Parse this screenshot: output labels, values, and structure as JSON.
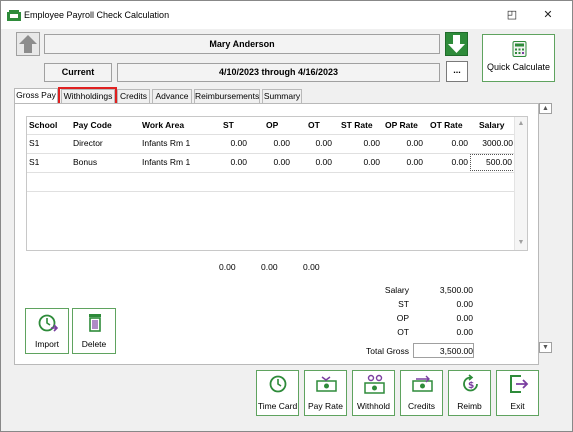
{
  "window": {
    "title": "Employee Payroll Check Calculation",
    "restore_glyph": "◰",
    "close_glyph": "✕"
  },
  "header": {
    "employee_name": "Mary Anderson",
    "period_label": "Current",
    "period_range": "4/10/2023 through 4/16/2023",
    "ellipsis_label": "...",
    "quick_calculate_label": "Quick Calculate"
  },
  "tabs": [
    {
      "label": "Gross Pay"
    },
    {
      "label": "Withholdings"
    },
    {
      "label": "Credits"
    },
    {
      "label": "Advance"
    },
    {
      "label": "Reimbursements"
    },
    {
      "label": "Summary"
    }
  ],
  "grid": {
    "columns": [
      "School",
      "Pay Code",
      "Work Area",
      "ST",
      "OP",
      "OT",
      "ST Rate",
      "OP Rate",
      "OT Rate",
      "Salary"
    ],
    "rows": [
      [
        "S1",
        "Director",
        "Infants Rm 1",
        "0.00",
        "0.00",
        "0.00",
        "0.00",
        "0.00",
        "0.00",
        "3000.00"
      ],
      [
        "S1",
        "Bonus",
        "Infants Rm 1",
        "0.00",
        "0.00",
        "0.00",
        "0.00",
        "0.00",
        "0.00",
        "500.00"
      ]
    ],
    "totals": {
      "st": "0.00",
      "op": "0.00",
      "ot": "0.00"
    }
  },
  "summary": {
    "salary_label": "Salary",
    "salary": "3,500.00",
    "st_label": "ST",
    "st": "0.00",
    "op_label": "OP",
    "op": "0.00",
    "ot_label": "OT",
    "ot": "0.00",
    "total_gross_label": "Total Gross",
    "total_gross": "3,500.00"
  },
  "panel_buttons": {
    "import": "Import",
    "delete": "Delete"
  },
  "footer_buttons": {
    "time_card": "Time Card",
    "pay_rate": "Pay Rate",
    "withhold": "Withhold",
    "credits": "Credits",
    "reimb": "Reimb",
    "exit": "Exit"
  },
  "colors": {
    "accent_green": "#2e8b3a",
    "highlight_red": "#e02020",
    "icon_purple": "#7a3ea0",
    "border_green": "#5fa35f"
  }
}
